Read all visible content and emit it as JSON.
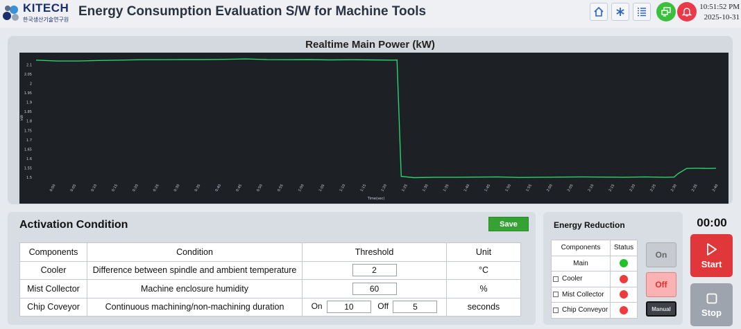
{
  "header": {
    "logo_text": "KITECH",
    "logo_subtext": "한국생산기술연구원",
    "title": "Energy Consumption Evaluation S/W for Machine Tools",
    "time": "10:51:52 PM",
    "date": "2025-10-31",
    "buttons": [
      {
        "name": "home-icon"
      },
      {
        "name": "asterisk-icon"
      },
      {
        "name": "list-icon"
      },
      {
        "name": "monitor-icon"
      },
      {
        "name": "bell-icon"
      }
    ],
    "colors": {
      "monitor": "#3cbf3c",
      "bell": "#ea3a4a"
    }
  },
  "chart_data": {
    "type": "line",
    "title": "Realtime Main Power (kW)",
    "xlabel": "Time(sec)",
    "ylabel": "kW",
    "ylim": [
      1.485,
      2.15
    ],
    "yticks": [
      2.1,
      2.05,
      2,
      1.95,
      1.9,
      1.85,
      1.8,
      1.75,
      1.7,
      1.65,
      1.6,
      1.55,
      1.5
    ],
    "ytick_labels": [
      "2.1",
      "2.05",
      "2",
      "1.95",
      "1.9",
      "1.85",
      "1.8",
      "1.75",
      "1.7",
      "1.65",
      "1.6",
      "1.55",
      "1.5"
    ],
    "xtick_labels": [
      "0:00",
      "0:05",
      "0:10",
      "0:15",
      "0:20",
      "0:25",
      "0:30",
      "0:35",
      "0:40",
      "0:45",
      "0:50",
      "0:55",
      "1:00",
      "1:05",
      "1:10",
      "1:15",
      "1:20",
      "1:25",
      "1:30",
      "1:35",
      "1:40",
      "1:45",
      "1:50",
      "1:55",
      "2:00",
      "2:05",
      "2:10",
      "2:15",
      "2:20",
      "2:25",
      "2:30",
      "2:35",
      "2:40"
    ],
    "x_range_sec": [
      0,
      162
    ],
    "line_color": "#2bd46b",
    "series": [
      {
        "x": [
          0,
          5,
          10,
          15,
          20,
          25,
          30,
          35,
          40,
          45,
          50,
          55,
          60,
          65,
          70,
          75,
          80,
          85,
          86,
          87,
          90,
          95,
          100,
          105,
          110,
          115,
          120,
          125,
          130,
          135,
          140,
          145,
          150,
          152,
          153,
          155,
          157,
          158,
          160,
          162
        ],
        "y": [
          2.125,
          2.12,
          2.12,
          2.123,
          2.125,
          2.127,
          2.127,
          2.128,
          2.128,
          2.129,
          2.131,
          2.128,
          2.127,
          2.128,
          2.126,
          2.127,
          2.126,
          2.125,
          2.126,
          1.505,
          1.498,
          1.5,
          1.5,
          1.501,
          1.502,
          1.499,
          1.5,
          1.501,
          1.502,
          1.501,
          1.5,
          1.502,
          1.5,
          1.501,
          1.52,
          1.547,
          1.548,
          1.548,
          1.547,
          1.548
        ]
      }
    ]
  },
  "activation": {
    "title": "Activation Condition",
    "save_label": "Save",
    "headers": [
      "Components",
      "Condition",
      "Threshold",
      "Unit"
    ],
    "rows": [
      {
        "component": "Cooler",
        "condition": "Difference between spindle and ambient temperature",
        "threshold": "2",
        "unit": "°C"
      },
      {
        "component": "Mist Collector",
        "condition": "Machine enclosure humidity",
        "threshold": "60",
        "unit": "%"
      },
      {
        "component": "Chip Coveyor",
        "condition": "Continuous machining/non-machining duration",
        "on_label": "On",
        "on_value": "10",
        "off_label": "Off",
        "off_value": "5",
        "unit": "seconds"
      }
    ]
  },
  "energy_reduction": {
    "title": "Energy Reduction",
    "headers": [
      "Components",
      "Status"
    ],
    "rows": [
      {
        "name": "Main",
        "status_color": "#21c12a",
        "checkbox": false
      },
      {
        "name": "Cooler",
        "status_color": "#ef3b3b",
        "checkbox": true
      },
      {
        "name": "Mist Collector",
        "status_color": "#ef3b3b",
        "checkbox": true
      },
      {
        "name": "Chip Conveyor",
        "status_color": "#ef3b3b",
        "checkbox": true
      }
    ],
    "on_label": "On",
    "off_label": "Off",
    "manual_label": "Manual"
  },
  "controls": {
    "timer": "00:00",
    "start_label": "Start",
    "stop_label": "Stop"
  }
}
